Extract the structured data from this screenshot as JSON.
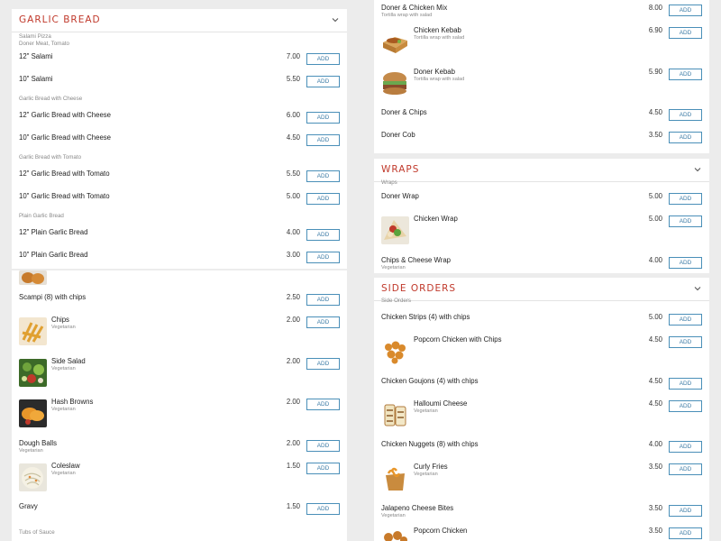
{
  "add_label": "ADD",
  "left_top": {
    "title": "Garlic Bread",
    "first_cat": "Salami Pizza",
    "first_cat_desc": "Doner Meat, Tomato",
    "items": [
      {
        "name": "12\" Salami",
        "price": "7.00"
      },
      {
        "name": "10\" Salami",
        "price": "5.50"
      },
      {
        "cat": "Garlic Bread with Cheese"
      },
      {
        "name": "12\" Garlic Bread with Cheese",
        "price": "6.00"
      },
      {
        "name": "10\" Garlic Bread with Cheese",
        "price": "4.50"
      },
      {
        "cat": "Garlic Bread with Tomato"
      },
      {
        "name": "12\" Garlic Bread with Tomato",
        "price": "5.50"
      },
      {
        "name": "10\" Garlic Bread with Tomato",
        "price": "5.00"
      },
      {
        "cat": "Plain Garlic Bread"
      },
      {
        "name": "12\" Plain Garlic Bread",
        "price": "4.00"
      },
      {
        "name": "10\" Plain Garlic Bread",
        "price": "3.00"
      }
    ]
  },
  "left_bottom": {
    "items": [
      {
        "name": "Scampi (8) with chips",
        "price": "2.50"
      },
      {
        "name": "Chips",
        "desc": "Vegetarian",
        "price": "2.00",
        "img": "chips"
      },
      {
        "name": "Side Salad",
        "desc": "Vegetarian",
        "price": "2.00",
        "img": "salad"
      },
      {
        "name": "Hash Browns",
        "desc": "Vegetarian",
        "price": "2.00",
        "img": "hashbrown"
      },
      {
        "name": "Dough Balls",
        "desc": "Vegetarian",
        "price": "2.00"
      },
      {
        "name": "Coleslaw",
        "desc": "Vegetarian",
        "price": "1.50",
        "img": "coleslaw"
      },
      {
        "name": "Gravy",
        "price": "1.50"
      }
    ],
    "footer_cat": "Tubs of Sauce"
  },
  "right_top": {
    "items": [
      {
        "name": "Doner & Chicken Mix",
        "desc": "Tortilla wrap with salad",
        "price": "8.00"
      },
      {
        "name": "Chicken Kebab",
        "desc": "Tortilla wrap with salad",
        "price": "6.90",
        "img": "kebabbox"
      },
      {
        "name": "Doner Kebab",
        "desc": "Tortilla wrap with salad",
        "price": "5.90",
        "img": "burger"
      },
      {
        "name": "Doner & Chips",
        "price": "4.50"
      },
      {
        "name": "Doner Cob",
        "price": "3.50"
      }
    ]
  },
  "wraps": {
    "title": "Wraps",
    "cat": "Wraps",
    "items": [
      {
        "name": "Doner Wrap",
        "price": "5.00"
      },
      {
        "name": "Chicken Wrap",
        "price": "5.00",
        "img": "wrap"
      },
      {
        "name": "Chips & Cheese Wrap",
        "desc": "Vegetarian",
        "price": "4.00"
      }
    ]
  },
  "side_orders": {
    "title": "Side Orders",
    "cat": "Side Orders",
    "items": [
      {
        "name": "Chicken Strips (4) with chips",
        "price": "5.00"
      },
      {
        "name": "Popcorn Chicken with Chips",
        "price": "4.50",
        "img": "popcorn"
      },
      {
        "name": "Chicken Goujons (4) with chips",
        "price": "4.50"
      },
      {
        "name": "Halloumi Cheese",
        "desc": "Vegetarian",
        "price": "4.50",
        "img": "halloumi"
      },
      {
        "name": "Chicken Nuggets (8) with chips",
        "price": "4.00"
      },
      {
        "name": "Curly Fries",
        "desc": "Vegetarian",
        "price": "3.50",
        "img": "curly"
      },
      {
        "name": "Jalapeno Cheese Bites",
        "desc": "Vegetarian",
        "price": "3.50"
      },
      {
        "name": "Popcorn Chicken",
        "price": "3.50",
        "img": "popcorn2"
      }
    ]
  },
  "colors": {
    "accent": "#c0392b",
    "button": "#3a7aa5",
    "panel": "#ffffff",
    "background": "#ececec"
  }
}
